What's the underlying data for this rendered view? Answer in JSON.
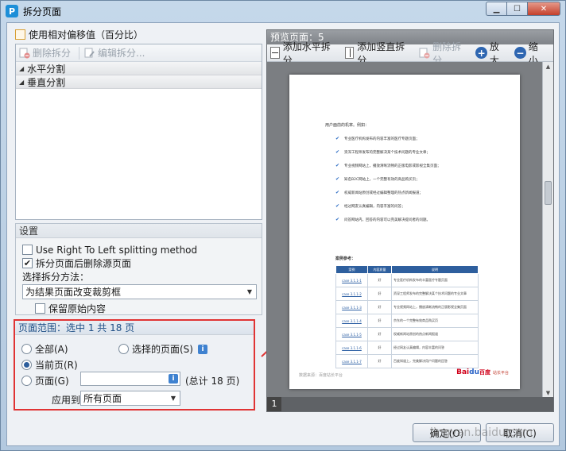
{
  "window": {
    "title": "拆分页面",
    "app_icon_letter": "P"
  },
  "left": {
    "use_offset_label": "使用相对偏移值（百分比）",
    "toolbar": {
      "delete_split": "删除拆分",
      "edit_split": "编辑拆分..."
    },
    "tree": [
      {
        "label": "水平分割"
      },
      {
        "label": "垂直分割"
      }
    ],
    "settings": {
      "title": "设置",
      "rtl_label": "Use Right To Left splitting method",
      "delete_source_label": "拆分页面后删除源页面",
      "method_label": "选择拆分方法：",
      "method_value": "为结果页面改变裁剪框",
      "keep_content_label": "保留原始内容"
    },
    "range": {
      "title": "页面范围：选中 1 共 18 页",
      "all_label": "全部(A)",
      "selected_pages_label": "选择的页面(S)",
      "current_page_label": "当前页(R)",
      "pages_label": "页面(G)",
      "pages_input_value": "",
      "total_text": "(总计 18 页)",
      "apply_to_label": "应用到：",
      "apply_to_value": "所有页面"
    }
  },
  "preview": {
    "title": "预览页面：5",
    "toolbar": {
      "add_horizontal": "添加水平拆分",
      "add_vertical": "添加竖直拆分",
      "delete_split": "删除拆分",
      "zoom_in": "放大",
      "zoom_out": "缩小"
    },
    "page_number": "1",
    "document": {
      "intro": "用户面前的机率。例如：",
      "bullets": [
        "专业医疗机构发布的内容丰富的医疗专题页面；",
        "资深工程师发布的完整解决某个技术问题的专业文章；",
        "专业视频网站上，播放清晰流畅的正版电影或影视全集页面；",
        "知名B2C网站上，一个完整有效的商品购买页；",
        "权威新闻站原创或经过编辑整理的热点新闻报道；",
        "经过网友认真编辑，内容丰富的问答；",
        "问答网站内，回答的内容可以完美解决提问者的问题。"
      ],
      "cases_title": "案例参考：",
      "table_headers": [
        "案例",
        "内容质量",
        "说明"
      ],
      "table_rows": [
        [
          "case 3.1.1-1",
          "好",
          "专业医疗机构发布的丰富医疗专题页面"
        ],
        [
          "case 3.1.1-2",
          "好",
          "资深工程师发布的完整解决某个技术问题的专业文章"
        ],
        [
          "case 3.1.1-3",
          "好",
          "专业视频网站上，播放清晰流畅的正版影视全集页面"
        ],
        [
          "case 3.1.1-4",
          "好",
          "京东的一个完整有效商品购买页"
        ],
        [
          "case 3.1.1-5",
          "好",
          "权威新闻站原创的热点新闻报道"
        ],
        [
          "case 3.1.1-6",
          "好",
          "经过网友认真编辑，内容丰富的问答"
        ],
        [
          "case 3.1.1-7",
          "好",
          "百度知道上，完美解决用户问题的回答"
        ]
      ],
      "footer_left": "数据来源：百度站长平台",
      "footer_logo_a": "Bai",
      "footer_logo_b": "du",
      "footer_logo_c": "百度",
      "footer_right": "站长平台"
    }
  },
  "buttons": {
    "ok": "确定(O)",
    "cancel": "取消(C)"
  },
  "watermark": "jingyan.baidu.com",
  "colors": {
    "highlight_border": "#e03434",
    "accent": "#2e66b1"
  }
}
